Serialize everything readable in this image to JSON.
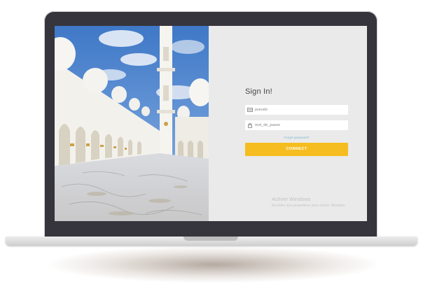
{
  "login": {
    "title": "Sign In!",
    "username_placeholder": "pseudo",
    "password_placeholder": "mot_de_passe",
    "forgot_label": "Forget password?",
    "connect_label": "CONNECT"
  },
  "watermark": {
    "title": "Activer Windows",
    "subtitle": "Accédez aux paramètres pour activer Windows"
  },
  "colors": {
    "accent": "#f5bd1f",
    "link": "#7fb9d6",
    "panel_bg": "#eaeaea",
    "bezel": "#36353d"
  },
  "icons": {
    "username": "id-card-icon",
    "password": "lock-icon"
  }
}
